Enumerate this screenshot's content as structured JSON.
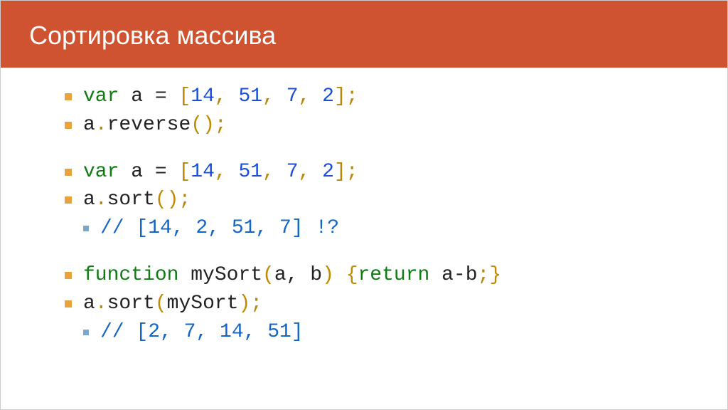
{
  "header": {
    "title": "Сортировка массива"
  },
  "lines": [
    {
      "kind": "code1",
      "var_kw": "var",
      "name": "a",
      "eq": " = ",
      "lb": "[",
      "n1": "14",
      "c1": ", ",
      "n2": "51",
      "c2": ", ",
      "n3": "7",
      "c3": ", ",
      "n4": "2",
      "rb": "]",
      "semi": ";"
    },
    {
      "kind": "call",
      "obj": "a",
      "dot": ".",
      "method": "reverse",
      "lp": "(",
      "rp": ")",
      "semi": ";"
    },
    {
      "kind": "code1",
      "gap": true,
      "var_kw": "var",
      "name": "a",
      "eq": " = ",
      "lb": "[",
      "n1": "14",
      "c1": ", ",
      "n2": "51",
      "c2": ", ",
      "n3": "7",
      "c3": ", ",
      "n4": "2",
      "rb": "]",
      "semi": ";"
    },
    {
      "kind": "call",
      "obj": "a",
      "dot": ".",
      "method": "sort",
      "lp": "(",
      "rp": ")",
      "semi": ";"
    },
    {
      "kind": "comment",
      "text": "// [14, 2, 51, 7] !?"
    },
    {
      "kind": "func",
      "gap": true,
      "fn_kw": "function",
      "fname": " mySort",
      "lp": "(",
      "args": "a, b",
      "rp": ") ",
      "lb": "{",
      "ret_kw": "return",
      "expr": " a-b",
      "semi1": ";",
      "rb": "}"
    },
    {
      "kind": "call2",
      "obj": "a",
      "dot": ".",
      "method": "sort",
      "lp": "(",
      "arg": "mySort",
      "rp": ")",
      "semi": ";"
    },
    {
      "kind": "comment",
      "text": "// [2, 7, 14, 51]"
    }
  ]
}
